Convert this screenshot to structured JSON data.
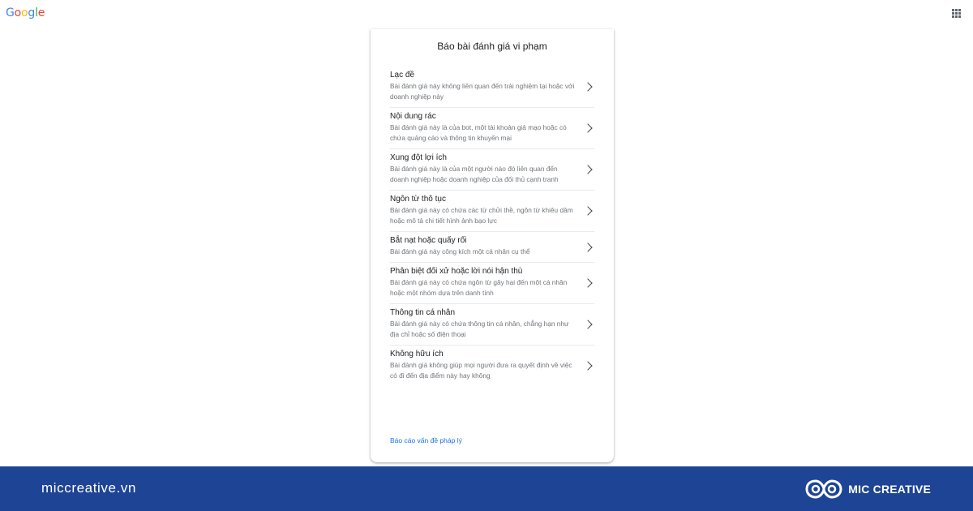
{
  "header": {
    "logo_letters": [
      {
        "ch": "G",
        "color": "#4285f4"
      },
      {
        "ch": "o",
        "color": "#ea4335"
      },
      {
        "ch": "o",
        "color": "#fbbc05"
      },
      {
        "ch": "g",
        "color": "#4285f4"
      },
      {
        "ch": "l",
        "color": "#34a853"
      },
      {
        "ch": "e",
        "color": "#ea4335"
      }
    ],
    "apps_icon": "apps-grid-icon"
  },
  "dialog": {
    "title": "Báo bài đánh giá vi phạm",
    "options": [
      {
        "title": "Lạc đề",
        "desc": "Bài đánh giá này không liên quan đến trải nghiệm tại hoặc với doanh nghiệp này"
      },
      {
        "title": "Nội dung rác",
        "desc": "Bài đánh giá này là của bot, một tài khoản giả mạo hoặc có chứa quảng cáo và thông tin khuyến mại"
      },
      {
        "title": "Xung đột lợi ích",
        "desc": "Bài đánh giá này là của một người nào đó liên quan đến doanh nghiệp hoặc doanh nghiệp của đối thủ cạnh tranh"
      },
      {
        "title": "Ngôn từ thô tục",
        "desc": "Bài đánh giá này có chứa các từ chửi thề, ngôn từ khiêu dâm hoặc mô tả chi tiết hình ảnh bạo lực"
      },
      {
        "title": "Bắt nạt hoặc quấy rối",
        "desc": "Bài đánh giá này công kích một cá nhân cụ thể"
      },
      {
        "title": "Phân biệt đối xử hoặc lời nói hận thù",
        "desc": "Bài đánh giá này có chứa ngôn từ gây hại đến một cá nhân hoặc một nhóm dựa trên danh tính"
      },
      {
        "title": "Thông tin cá nhân",
        "desc": "Bài đánh giá này có chứa thông tin cá nhân, chẳng hạn như địa chỉ hoặc số điện thoại"
      },
      {
        "title": "Không hữu ích",
        "desc": "Bài đánh giá không giúp mọi người đưa ra quyết định về việc có đi đến địa điểm này hay không"
      }
    ],
    "legal_link": "Báo cáo vấn đề pháp lý"
  },
  "footer": {
    "site": "miccreative.vn",
    "brand": "MIC CREATIVE"
  },
  "colors": {
    "footer_bg": "#1e4496",
    "link": "#1a73e8"
  }
}
